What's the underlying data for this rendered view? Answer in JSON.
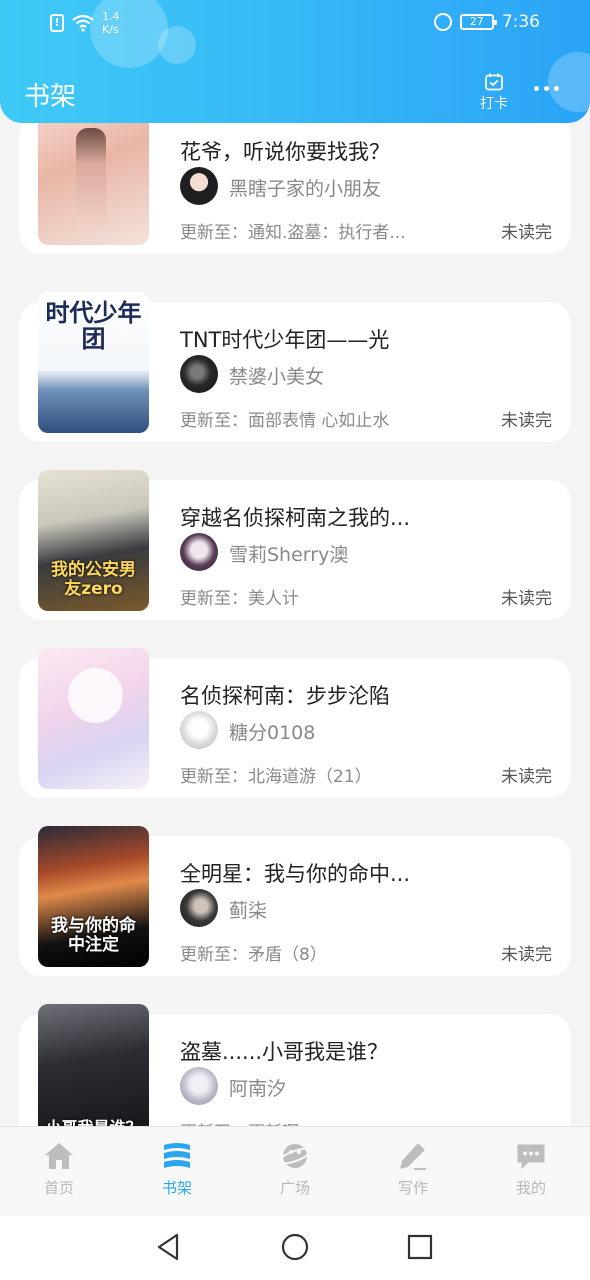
{
  "status_bar": {
    "speed_value": "1.4",
    "speed_unit": "K/s",
    "battery": "27",
    "time": "7:36"
  },
  "header": {
    "title": "书架",
    "checkin_label": "打卡"
  },
  "books": [
    {
      "title": "花爷，听说你要找我？",
      "author": "黑瞎子家的小朋友",
      "update": "更新至：通知.盗墓：执行者...",
      "status": "未读完"
    },
    {
      "title": "TNT时代少年团——光",
      "author": "禁婆小美女",
      "update": "更新至：面部表情 心如止水",
      "status": "未读完",
      "cover_text": "时代少年团"
    },
    {
      "title": "穿越名侦探柯南之我的...",
      "author": "雪莉Sherry澳",
      "update": "更新至：美人计",
      "status": "未读完",
      "cover_text": "我的公安男友zero"
    },
    {
      "title": "名侦探柯南：步步沦陷",
      "author": "糖分0108",
      "update": "更新至：北海道游（21）",
      "status": "未读完"
    },
    {
      "title": "全明星：我与你的命中...",
      "author": "蓟柒",
      "update": "更新至：矛盾（8）",
      "status": "未读完",
      "cover_text": "我与你的命中注定"
    },
    {
      "title": "盗墓......小哥我是谁？",
      "author": "阿南汐",
      "update": "更新至：更新啊",
      "status": "",
      "cover_text": "小哥我是谁？"
    }
  ],
  "bottom_nav": [
    {
      "label": "首页",
      "icon": "home-icon"
    },
    {
      "label": "书架",
      "icon": "bookshelf-icon"
    },
    {
      "label": "广场",
      "icon": "planet-icon"
    },
    {
      "label": "写作",
      "icon": "pen-icon"
    },
    {
      "label": "我的",
      "icon": "chat-bubble-icon"
    }
  ],
  "colors": {
    "accent": "#2ba6ef",
    "header_start": "#3fcaf6",
    "header_end": "#2aa4f6"
  }
}
